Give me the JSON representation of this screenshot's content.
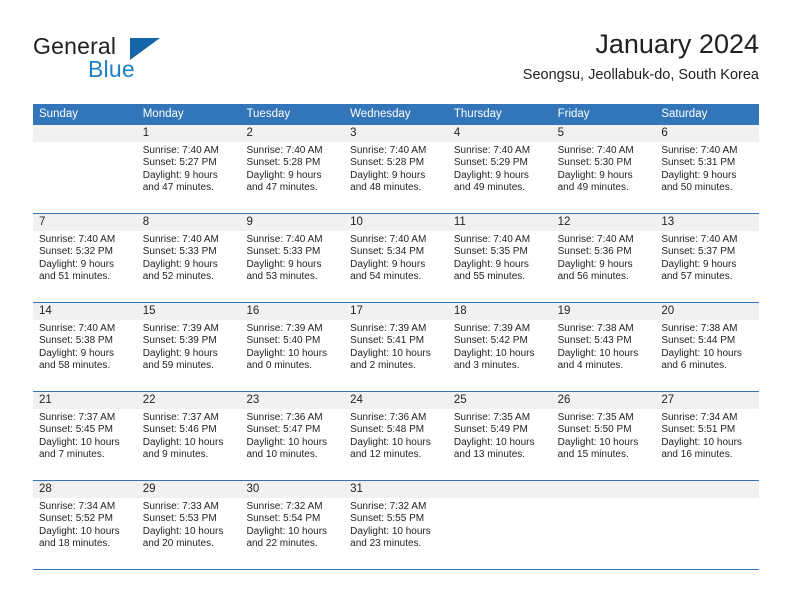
{
  "brand": {
    "name_primary": "General",
    "name_secondary": "Blue",
    "triangle_icon": "triangle-logo-icon",
    "primary_color": "#231f20",
    "secondary_color": "#1f7fc4"
  },
  "header": {
    "title": "January 2024",
    "subtitle": "Seongsu, Jeollabuk-do, South Korea"
  },
  "theme": {
    "header_bg": "#3275b8",
    "header_text": "#ffffff",
    "daynum_bg": "#f1f1f1",
    "grid_line": "#3275b8",
    "body_text": "#231f20"
  },
  "calendar": {
    "weekdays": [
      "Sunday",
      "Monday",
      "Tuesday",
      "Wednesday",
      "Thursday",
      "Friday",
      "Saturday"
    ],
    "weeks": [
      [
        {
          "day": "",
          "sunrise": "",
          "sunset": "",
          "daylight": ""
        },
        {
          "day": "1",
          "sunrise": "Sunrise: 7:40 AM",
          "sunset": "Sunset: 5:27 PM",
          "daylight": "Daylight: 9 hours and 47 minutes."
        },
        {
          "day": "2",
          "sunrise": "Sunrise: 7:40 AM",
          "sunset": "Sunset: 5:28 PM",
          "daylight": "Daylight: 9 hours and 47 minutes."
        },
        {
          "day": "3",
          "sunrise": "Sunrise: 7:40 AM",
          "sunset": "Sunset: 5:28 PM",
          "daylight": "Daylight: 9 hours and 48 minutes."
        },
        {
          "day": "4",
          "sunrise": "Sunrise: 7:40 AM",
          "sunset": "Sunset: 5:29 PM",
          "daylight": "Daylight: 9 hours and 49 minutes."
        },
        {
          "day": "5",
          "sunrise": "Sunrise: 7:40 AM",
          "sunset": "Sunset: 5:30 PM",
          "daylight": "Daylight: 9 hours and 49 minutes."
        },
        {
          "day": "6",
          "sunrise": "Sunrise: 7:40 AM",
          "sunset": "Sunset: 5:31 PM",
          "daylight": "Daylight: 9 hours and 50 minutes."
        }
      ],
      [
        {
          "day": "7",
          "sunrise": "Sunrise: 7:40 AM",
          "sunset": "Sunset: 5:32 PM",
          "daylight": "Daylight: 9 hours and 51 minutes."
        },
        {
          "day": "8",
          "sunrise": "Sunrise: 7:40 AM",
          "sunset": "Sunset: 5:33 PM",
          "daylight": "Daylight: 9 hours and 52 minutes."
        },
        {
          "day": "9",
          "sunrise": "Sunrise: 7:40 AM",
          "sunset": "Sunset: 5:33 PM",
          "daylight": "Daylight: 9 hours and 53 minutes."
        },
        {
          "day": "10",
          "sunrise": "Sunrise: 7:40 AM",
          "sunset": "Sunset: 5:34 PM",
          "daylight": "Daylight: 9 hours and 54 minutes."
        },
        {
          "day": "11",
          "sunrise": "Sunrise: 7:40 AM",
          "sunset": "Sunset: 5:35 PM",
          "daylight": "Daylight: 9 hours and 55 minutes."
        },
        {
          "day": "12",
          "sunrise": "Sunrise: 7:40 AM",
          "sunset": "Sunset: 5:36 PM",
          "daylight": "Daylight: 9 hours and 56 minutes."
        },
        {
          "day": "13",
          "sunrise": "Sunrise: 7:40 AM",
          "sunset": "Sunset: 5:37 PM",
          "daylight": "Daylight: 9 hours and 57 minutes."
        }
      ],
      [
        {
          "day": "14",
          "sunrise": "Sunrise: 7:40 AM",
          "sunset": "Sunset: 5:38 PM",
          "daylight": "Daylight: 9 hours and 58 minutes."
        },
        {
          "day": "15",
          "sunrise": "Sunrise: 7:39 AM",
          "sunset": "Sunset: 5:39 PM",
          "daylight": "Daylight: 9 hours and 59 minutes."
        },
        {
          "day": "16",
          "sunrise": "Sunrise: 7:39 AM",
          "sunset": "Sunset: 5:40 PM",
          "daylight": "Daylight: 10 hours and 0 minutes."
        },
        {
          "day": "17",
          "sunrise": "Sunrise: 7:39 AM",
          "sunset": "Sunset: 5:41 PM",
          "daylight": "Daylight: 10 hours and 2 minutes."
        },
        {
          "day": "18",
          "sunrise": "Sunrise: 7:39 AM",
          "sunset": "Sunset: 5:42 PM",
          "daylight": "Daylight: 10 hours and 3 minutes."
        },
        {
          "day": "19",
          "sunrise": "Sunrise: 7:38 AM",
          "sunset": "Sunset: 5:43 PM",
          "daylight": "Daylight: 10 hours and 4 minutes."
        },
        {
          "day": "20",
          "sunrise": "Sunrise: 7:38 AM",
          "sunset": "Sunset: 5:44 PM",
          "daylight": "Daylight: 10 hours and 6 minutes."
        }
      ],
      [
        {
          "day": "21",
          "sunrise": "Sunrise: 7:37 AM",
          "sunset": "Sunset: 5:45 PM",
          "daylight": "Daylight: 10 hours and 7 minutes."
        },
        {
          "day": "22",
          "sunrise": "Sunrise: 7:37 AM",
          "sunset": "Sunset: 5:46 PM",
          "daylight": "Daylight: 10 hours and 9 minutes."
        },
        {
          "day": "23",
          "sunrise": "Sunrise: 7:36 AM",
          "sunset": "Sunset: 5:47 PM",
          "daylight": "Daylight: 10 hours and 10 minutes."
        },
        {
          "day": "24",
          "sunrise": "Sunrise: 7:36 AM",
          "sunset": "Sunset: 5:48 PM",
          "daylight": "Daylight: 10 hours and 12 minutes."
        },
        {
          "day": "25",
          "sunrise": "Sunrise: 7:35 AM",
          "sunset": "Sunset: 5:49 PM",
          "daylight": "Daylight: 10 hours and 13 minutes."
        },
        {
          "day": "26",
          "sunrise": "Sunrise: 7:35 AM",
          "sunset": "Sunset: 5:50 PM",
          "daylight": "Daylight: 10 hours and 15 minutes."
        },
        {
          "day": "27",
          "sunrise": "Sunrise: 7:34 AM",
          "sunset": "Sunset: 5:51 PM",
          "daylight": "Daylight: 10 hours and 16 minutes."
        }
      ],
      [
        {
          "day": "28",
          "sunrise": "Sunrise: 7:34 AM",
          "sunset": "Sunset: 5:52 PM",
          "daylight": "Daylight: 10 hours and 18 minutes."
        },
        {
          "day": "29",
          "sunrise": "Sunrise: 7:33 AM",
          "sunset": "Sunset: 5:53 PM",
          "daylight": "Daylight: 10 hours and 20 minutes."
        },
        {
          "day": "30",
          "sunrise": "Sunrise: 7:32 AM",
          "sunset": "Sunset: 5:54 PM",
          "daylight": "Daylight: 10 hours and 22 minutes."
        },
        {
          "day": "31",
          "sunrise": "Sunrise: 7:32 AM",
          "sunset": "Sunset: 5:55 PM",
          "daylight": "Daylight: 10 hours and 23 minutes."
        },
        {
          "day": "",
          "sunrise": "",
          "sunset": "",
          "daylight": ""
        },
        {
          "day": "",
          "sunrise": "",
          "sunset": "",
          "daylight": ""
        },
        {
          "day": "",
          "sunrise": "",
          "sunset": "",
          "daylight": ""
        }
      ]
    ]
  }
}
